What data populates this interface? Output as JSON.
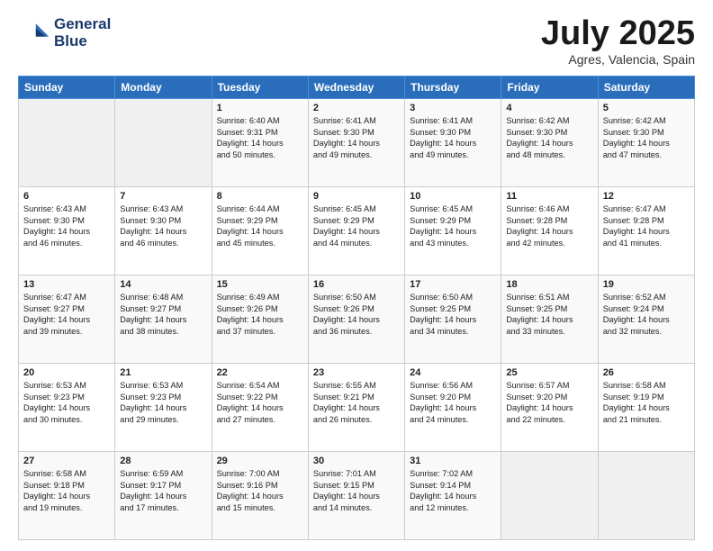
{
  "logo": {
    "line1": "General",
    "line2": "Blue"
  },
  "title": "July 2025",
  "location": "Agres, Valencia, Spain",
  "days_of_week": [
    "Sunday",
    "Monday",
    "Tuesday",
    "Wednesday",
    "Thursday",
    "Friday",
    "Saturday"
  ],
  "weeks": [
    [
      {
        "day": "",
        "info": ""
      },
      {
        "day": "",
        "info": ""
      },
      {
        "day": "1",
        "info": "Sunrise: 6:40 AM\nSunset: 9:31 PM\nDaylight: 14 hours\nand 50 minutes."
      },
      {
        "day": "2",
        "info": "Sunrise: 6:41 AM\nSunset: 9:30 PM\nDaylight: 14 hours\nand 49 minutes."
      },
      {
        "day": "3",
        "info": "Sunrise: 6:41 AM\nSunset: 9:30 PM\nDaylight: 14 hours\nand 49 minutes."
      },
      {
        "day": "4",
        "info": "Sunrise: 6:42 AM\nSunset: 9:30 PM\nDaylight: 14 hours\nand 48 minutes."
      },
      {
        "day": "5",
        "info": "Sunrise: 6:42 AM\nSunset: 9:30 PM\nDaylight: 14 hours\nand 47 minutes."
      }
    ],
    [
      {
        "day": "6",
        "info": "Sunrise: 6:43 AM\nSunset: 9:30 PM\nDaylight: 14 hours\nand 46 minutes."
      },
      {
        "day": "7",
        "info": "Sunrise: 6:43 AM\nSunset: 9:30 PM\nDaylight: 14 hours\nand 46 minutes."
      },
      {
        "day": "8",
        "info": "Sunrise: 6:44 AM\nSunset: 9:29 PM\nDaylight: 14 hours\nand 45 minutes."
      },
      {
        "day": "9",
        "info": "Sunrise: 6:45 AM\nSunset: 9:29 PM\nDaylight: 14 hours\nand 44 minutes."
      },
      {
        "day": "10",
        "info": "Sunrise: 6:45 AM\nSunset: 9:29 PM\nDaylight: 14 hours\nand 43 minutes."
      },
      {
        "day": "11",
        "info": "Sunrise: 6:46 AM\nSunset: 9:28 PM\nDaylight: 14 hours\nand 42 minutes."
      },
      {
        "day": "12",
        "info": "Sunrise: 6:47 AM\nSunset: 9:28 PM\nDaylight: 14 hours\nand 41 minutes."
      }
    ],
    [
      {
        "day": "13",
        "info": "Sunrise: 6:47 AM\nSunset: 9:27 PM\nDaylight: 14 hours\nand 39 minutes."
      },
      {
        "day": "14",
        "info": "Sunrise: 6:48 AM\nSunset: 9:27 PM\nDaylight: 14 hours\nand 38 minutes."
      },
      {
        "day": "15",
        "info": "Sunrise: 6:49 AM\nSunset: 9:26 PM\nDaylight: 14 hours\nand 37 minutes."
      },
      {
        "day": "16",
        "info": "Sunrise: 6:50 AM\nSunset: 9:26 PM\nDaylight: 14 hours\nand 36 minutes."
      },
      {
        "day": "17",
        "info": "Sunrise: 6:50 AM\nSunset: 9:25 PM\nDaylight: 14 hours\nand 34 minutes."
      },
      {
        "day": "18",
        "info": "Sunrise: 6:51 AM\nSunset: 9:25 PM\nDaylight: 14 hours\nand 33 minutes."
      },
      {
        "day": "19",
        "info": "Sunrise: 6:52 AM\nSunset: 9:24 PM\nDaylight: 14 hours\nand 32 minutes."
      }
    ],
    [
      {
        "day": "20",
        "info": "Sunrise: 6:53 AM\nSunset: 9:23 PM\nDaylight: 14 hours\nand 30 minutes."
      },
      {
        "day": "21",
        "info": "Sunrise: 6:53 AM\nSunset: 9:23 PM\nDaylight: 14 hours\nand 29 minutes."
      },
      {
        "day": "22",
        "info": "Sunrise: 6:54 AM\nSunset: 9:22 PM\nDaylight: 14 hours\nand 27 minutes."
      },
      {
        "day": "23",
        "info": "Sunrise: 6:55 AM\nSunset: 9:21 PM\nDaylight: 14 hours\nand 26 minutes."
      },
      {
        "day": "24",
        "info": "Sunrise: 6:56 AM\nSunset: 9:20 PM\nDaylight: 14 hours\nand 24 minutes."
      },
      {
        "day": "25",
        "info": "Sunrise: 6:57 AM\nSunset: 9:20 PM\nDaylight: 14 hours\nand 22 minutes."
      },
      {
        "day": "26",
        "info": "Sunrise: 6:58 AM\nSunset: 9:19 PM\nDaylight: 14 hours\nand 21 minutes."
      }
    ],
    [
      {
        "day": "27",
        "info": "Sunrise: 6:58 AM\nSunset: 9:18 PM\nDaylight: 14 hours\nand 19 minutes."
      },
      {
        "day": "28",
        "info": "Sunrise: 6:59 AM\nSunset: 9:17 PM\nDaylight: 14 hours\nand 17 minutes."
      },
      {
        "day": "29",
        "info": "Sunrise: 7:00 AM\nSunset: 9:16 PM\nDaylight: 14 hours\nand 15 minutes."
      },
      {
        "day": "30",
        "info": "Sunrise: 7:01 AM\nSunset: 9:15 PM\nDaylight: 14 hours\nand 14 minutes."
      },
      {
        "day": "31",
        "info": "Sunrise: 7:02 AM\nSunset: 9:14 PM\nDaylight: 14 hours\nand 12 minutes."
      },
      {
        "day": "",
        "info": ""
      },
      {
        "day": "",
        "info": ""
      }
    ]
  ]
}
